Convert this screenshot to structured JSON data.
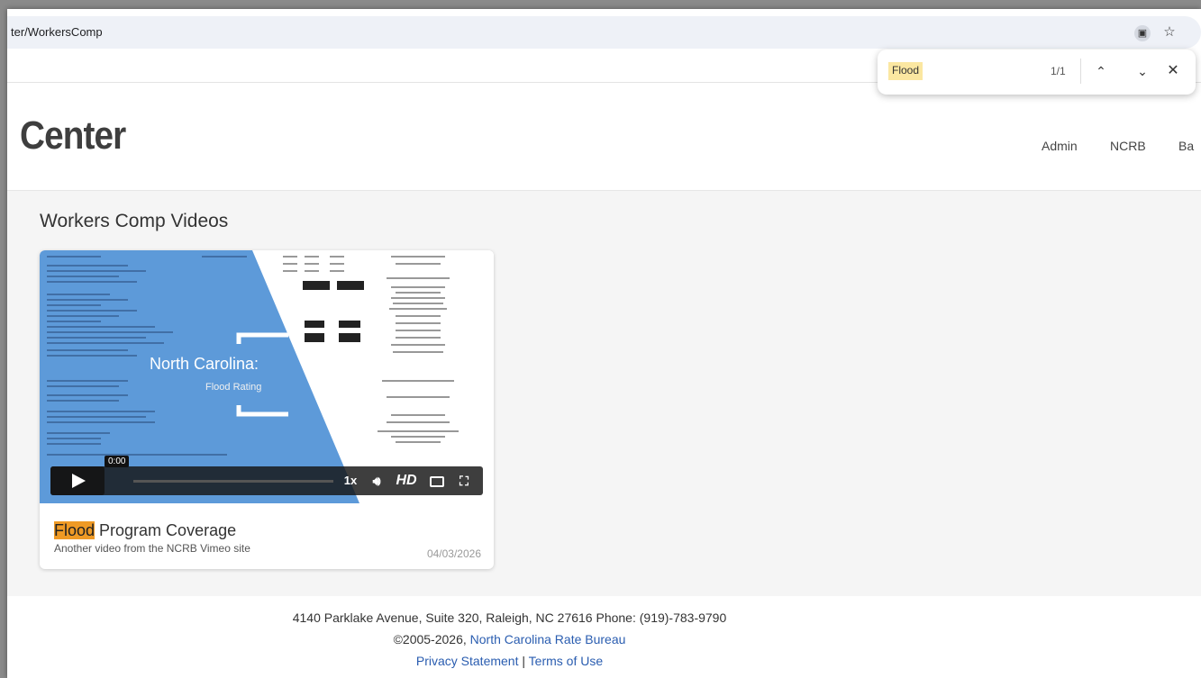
{
  "browser": {
    "url": "ter/WorkersComp",
    "icons": [
      "page-info-icon",
      "bookmark-star-icon"
    ]
  },
  "find_bar": {
    "query": "Flood",
    "count": "1/1"
  },
  "header": {
    "title": "Center",
    "nav": [
      "Admin",
      "NCRB",
      "Ba"
    ]
  },
  "main": {
    "section_title": "Workers Comp Videos",
    "video": {
      "overlay_title": "North Carolina:",
      "overlay_subtitle": "Flood Rating",
      "time": "0:00",
      "speed": "1x",
      "hd": "HD",
      "progress": 0,
      "title_highlight": "Flood",
      "title_rest": " Program Coverage",
      "description": "Another video from the NCRB Vimeo site",
      "date": "04/03/2026"
    }
  },
  "footer": {
    "address": "4140 Parklake Avenue, Suite 320, Raleigh, NC 27616 Phone: (919)-783-9790",
    "copyright": "©2005-2026, ",
    "org_link": "North Carolina Rate Bureau",
    "privacy": "Privacy Statement",
    "separator": " | ",
    "terms": "Terms of Use"
  },
  "colors": {
    "highlight_find": "#fbe7a1",
    "highlight_text": "#ef9a25",
    "thumb_blue": "#5d9ad9",
    "link": "#2a5db0"
  }
}
